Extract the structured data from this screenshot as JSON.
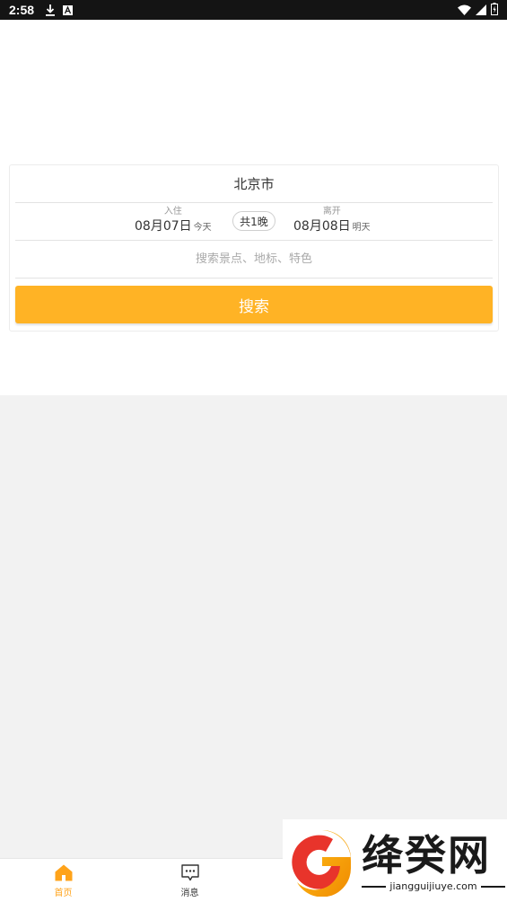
{
  "status_bar": {
    "time": "2:58",
    "icons": [
      "download-icon",
      "font-a-icon",
      "wifi-icon",
      "signal-icon",
      "battery-icon"
    ]
  },
  "search_card": {
    "city": "北京市",
    "checkin": {
      "label": "入住",
      "date": "08月07日",
      "day": "今天"
    },
    "checkout": {
      "label": "离开",
      "date": "08月08日",
      "day": "明天"
    },
    "nights": "共1晚",
    "keyword_placeholder": "搜索景点、地标、特色",
    "search_button": "搜索"
  },
  "bottom_nav": {
    "items": [
      {
        "label": "首页",
        "icon": "home-icon",
        "active": true
      },
      {
        "label": "消息",
        "icon": "message-icon",
        "active": false
      }
    ]
  },
  "watermark": {
    "brand": "绛癸网",
    "url": "jiangguijiuye.com"
  },
  "colors": {
    "accent": "#ffb325",
    "active_nav": "#ffa31a",
    "background": "#f2f2f2"
  }
}
